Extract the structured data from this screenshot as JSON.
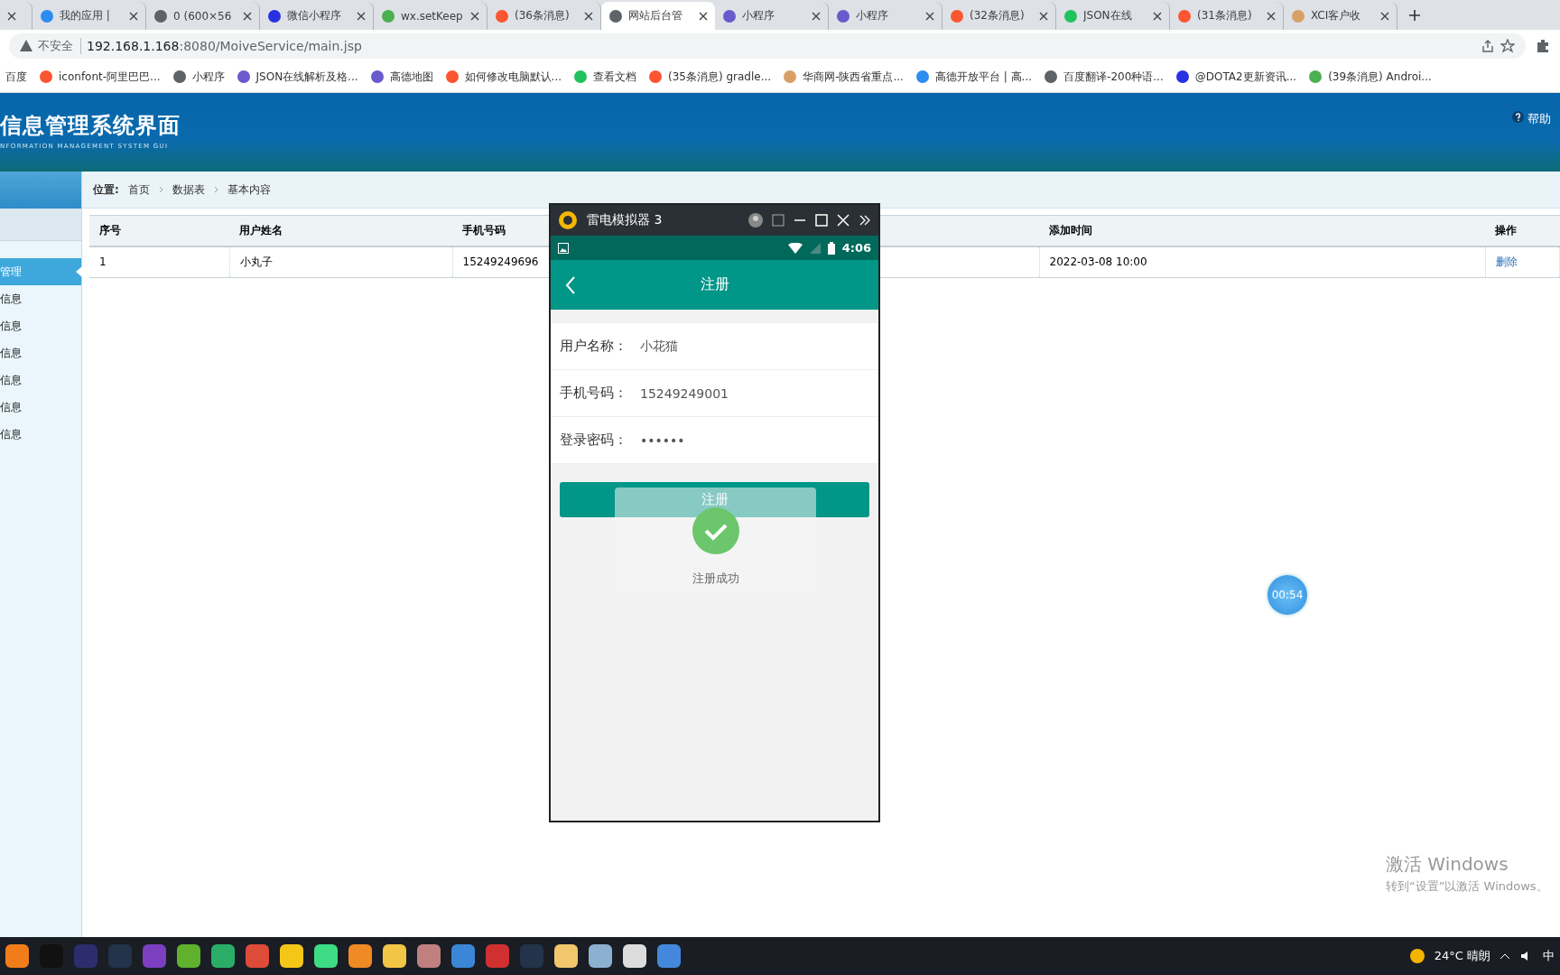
{
  "browser": {
    "tabs": [
      {
        "label": "我的应用 | ",
        "selected": false
      },
      {
        "label": "0 (600×56",
        "selected": false
      },
      {
        "label": "微信小程序",
        "selected": false
      },
      {
        "label": "wx.setKeep",
        "selected": false
      },
      {
        "label": "(36条消息)",
        "selected": false
      },
      {
        "label": "网站后台管",
        "selected": true
      },
      {
        "label": "小程序",
        "selected": false
      },
      {
        "label": "小程序",
        "selected": false
      },
      {
        "label": "(32条消息)",
        "selected": false
      },
      {
        "label": "JSON在线",
        "selected": false
      },
      {
        "label": "(31条消息)",
        "selected": false
      },
      {
        "label": "XCI客户收",
        "selected": false
      }
    ],
    "security": "不安全",
    "url": {
      "host": "192.168.1.168",
      "path": ":8080/MoiveService/main.jsp"
    },
    "bookmarks": [
      "百度",
      "iconfont-阿里巴巴...",
      "小程序",
      "JSON在线解析及格...",
      "高德地图",
      "如何修改电脑默认...",
      "查看文档",
      "(35条消息) gradle...",
      "华商网-陕西省重点...",
      "高德开放平台 | 高...",
      "百度翻译-200种语...",
      "@DOTA2更新资讯...",
      "(39条消息) Androi..."
    ]
  },
  "header": {
    "title": "信息管理系统界面",
    "subtitle": "NFORMATION MANAGEMENT SYSTEM GUI",
    "help": "帮助"
  },
  "sidebar": {
    "items": [
      {
        "label": "管理",
        "selected": true
      },
      {
        "label": "信息",
        "selected": false
      },
      {
        "label": "信息",
        "selected": false
      },
      {
        "label": "信息",
        "selected": false
      },
      {
        "label": "信息",
        "selected": false
      },
      {
        "label": "信息",
        "selected": false
      },
      {
        "label": "信息",
        "selected": false
      }
    ]
  },
  "breadcrumb": {
    "label": "位置:",
    "items": [
      "首页",
      "数据表",
      "基本内容"
    ]
  },
  "table": {
    "columns": [
      "序号",
      "用户姓名",
      "手机号码",
      "添加时间",
      "操作"
    ],
    "rows": [
      {
        "cells": [
          "1",
          "小丸子",
          "15249249696",
          "2022-03-08 10:00"
        ],
        "action": "删除"
      }
    ]
  },
  "emulator": {
    "title": "雷电模拟器 3",
    "time": "4:06",
    "app_title": "注册",
    "fields": [
      {
        "label": "用户名称：",
        "value": "小花猫"
      },
      {
        "label": "手机号码：",
        "value": "15249249001"
      },
      {
        "label": "登录密码：",
        "value": "••••••"
      }
    ],
    "button": "注册",
    "toast": "注册成功"
  },
  "timer": "00:54",
  "watermark": {
    "title": "激活 Windows",
    "text": "转到“设置”以激活 Windows。"
  },
  "taskbar": {
    "weather": "24°C 晴朗",
    "ime": "中"
  }
}
